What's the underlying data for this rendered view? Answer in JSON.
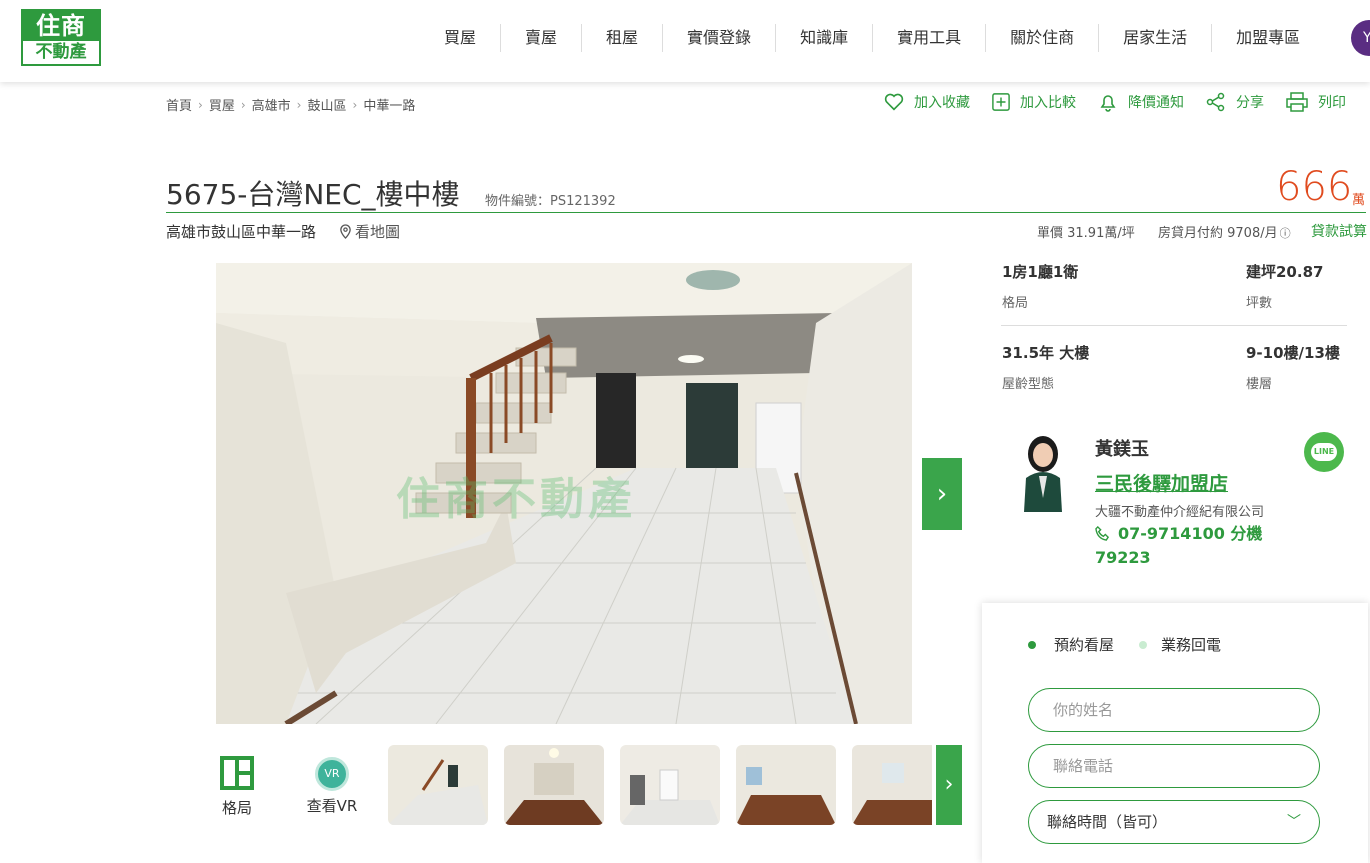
{
  "brand": {
    "logo_top": "住商",
    "logo_bottom": "不動產",
    "green": "#2e9a3e",
    "price_color": "#e04b1f"
  },
  "nav": {
    "items": [
      "買屋",
      "賣屋",
      "租屋",
      "實價登錄",
      "知識庫",
      "實用工具",
      "關於住商",
      "居家生活",
      "加盟專區"
    ],
    "avatar_letter": "Y"
  },
  "breadcrumb": [
    "首頁",
    "買屋",
    "高雄市",
    "鼓山區",
    "中華一路"
  ],
  "actions": {
    "favorite": "加入收藏",
    "compare": "加入比較",
    "price_alert": "降價通知",
    "share": "分享",
    "print": "列印"
  },
  "listing": {
    "title": "5675-台灣NEC_樓中樓",
    "object_id": "物件編號：PS121392",
    "price": "666",
    "price_unit": "萬",
    "address": "高雄市鼓山區中華一路",
    "map_link": "看地圖",
    "unit_price": "單價  31.91萬/坪",
    "mortgage": "房貸月付約  9708/月",
    "loan_calc": "貸款試算",
    "watermark": "住商不動產"
  },
  "specs": [
    {
      "value": "1房1廳1衛",
      "label": "格局"
    },
    {
      "value": "建坪20.87",
      "label": "坪數"
    },
    {
      "value": "31.5年 大樓",
      "label": "屋齡型態"
    },
    {
      "value": "9-10樓/13樓",
      "label": "樓層"
    }
  ],
  "tools": {
    "floorplan": "格局",
    "vr": "查看VR",
    "vr_badge": "VR"
  },
  "agent": {
    "name": "黃鎂玉",
    "store": "三民後驛加盟店",
    "company": "大疆不動產仲介經紀有限公司",
    "phone": "07-9714100 分機79223",
    "line_badge": "LINE"
  },
  "form": {
    "tab_viewing": "預約看屋",
    "tab_callback": "業務回電",
    "name_placeholder": "你的姓名",
    "phone_placeholder": "聯絡電話",
    "time_value": "聯絡時間（皆可）"
  }
}
